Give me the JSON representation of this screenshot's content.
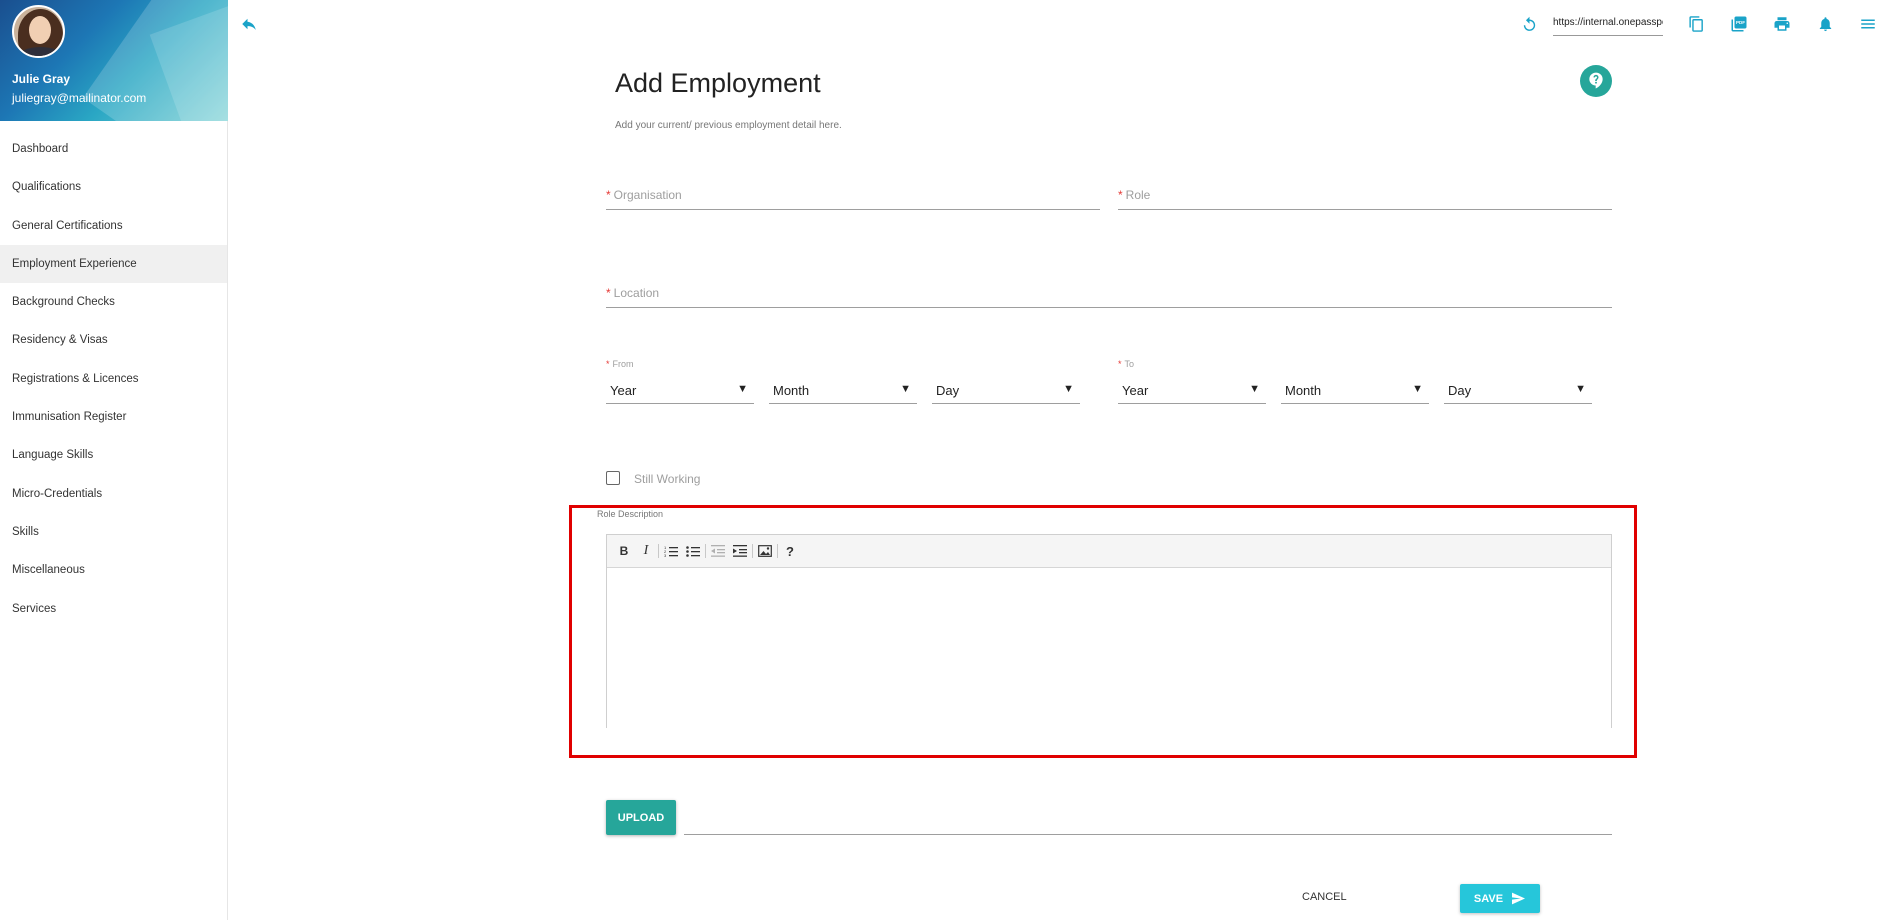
{
  "profile": {
    "name": "Julie Gray",
    "email": "juliegray@mailinator.com"
  },
  "sidebar": {
    "items": [
      {
        "label": "Dashboard",
        "active": false
      },
      {
        "label": "Qualifications",
        "active": false
      },
      {
        "label": "General Certifications",
        "active": false
      },
      {
        "label": "Employment Experience",
        "active": true
      },
      {
        "label": "Background Checks",
        "active": false
      },
      {
        "label": "Residency & Visas",
        "active": false
      },
      {
        "label": "Registrations & Licences",
        "active": false
      },
      {
        "label": "Immunisation Register",
        "active": false
      },
      {
        "label": "Language Skills",
        "active": false
      },
      {
        "label": "Micro-Credentials",
        "active": false
      },
      {
        "label": "Skills",
        "active": false
      },
      {
        "label": "Miscellaneous",
        "active": false
      },
      {
        "label": "Services",
        "active": false
      }
    ]
  },
  "topbar": {
    "url": "https://internal.onepassport"
  },
  "form": {
    "title": "Add Employment",
    "subtitle": "Add your current/ previous employment detail here.",
    "organisation_label": "Organisation",
    "role_label": "Role",
    "location_label": "Location",
    "required_mark": "*",
    "from_label": "From",
    "to_label": "To",
    "from": {
      "year": "Year",
      "month": "Month",
      "day": "Day"
    },
    "to": {
      "year": "Year",
      "month": "Month",
      "day": "Day"
    },
    "still_working_label": "Still Working",
    "role_description_label": "Role Description",
    "upload_label": "UPLOAD",
    "cancel_label": "CANCEL",
    "save_label": "SAVE"
  },
  "colors": {
    "accent_teal": "#26a69a",
    "save_cyan": "#26c6da",
    "highlight_red": "#e00000",
    "icon_blue": "#1aa3c8"
  }
}
